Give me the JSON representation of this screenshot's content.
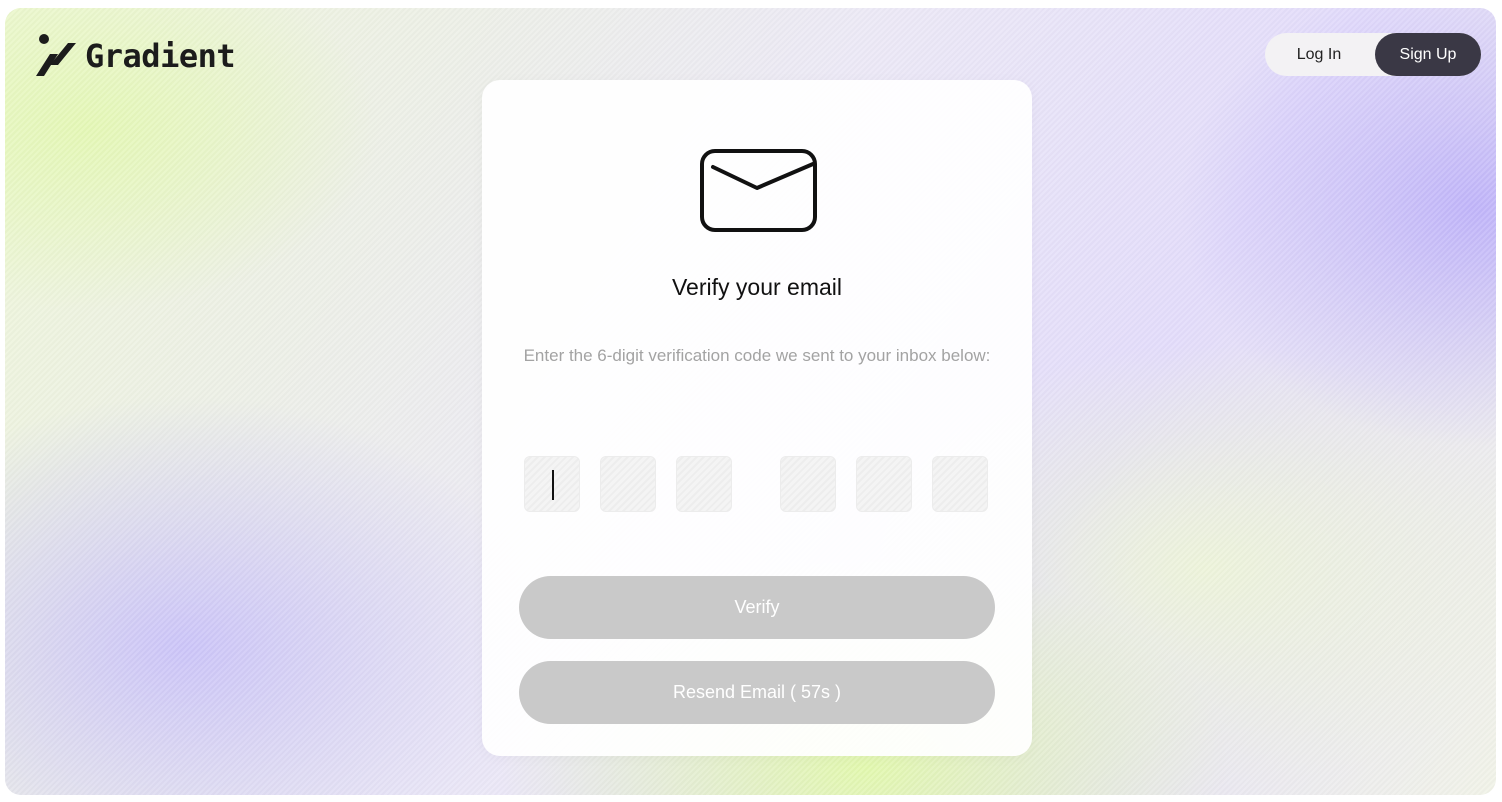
{
  "brand": {
    "name": "Gradient",
    "logo_icon": "slash-dot-logo-icon"
  },
  "nav": {
    "login_label": "Log In",
    "signup_label": "Sign Up",
    "active": "signup"
  },
  "card": {
    "icon": "envelope-icon",
    "title": "Verify your email",
    "subtitle": "Enter the 6-digit verification code we sent to your inbox below:",
    "code_inputs": [
      "",
      "",
      "",
      "",
      "",
      ""
    ],
    "focused_input": 1,
    "verify_label": "Verify",
    "resend_label": "Resend Email ( 57s )"
  },
  "colors": {
    "signup_bg": "#3a3845",
    "disabled_button": "#c9c9c9",
    "subtitle_text": "#a3a3a3",
    "accent_lavender": "#beb2fa",
    "accent_lime": "#e2faaa"
  }
}
